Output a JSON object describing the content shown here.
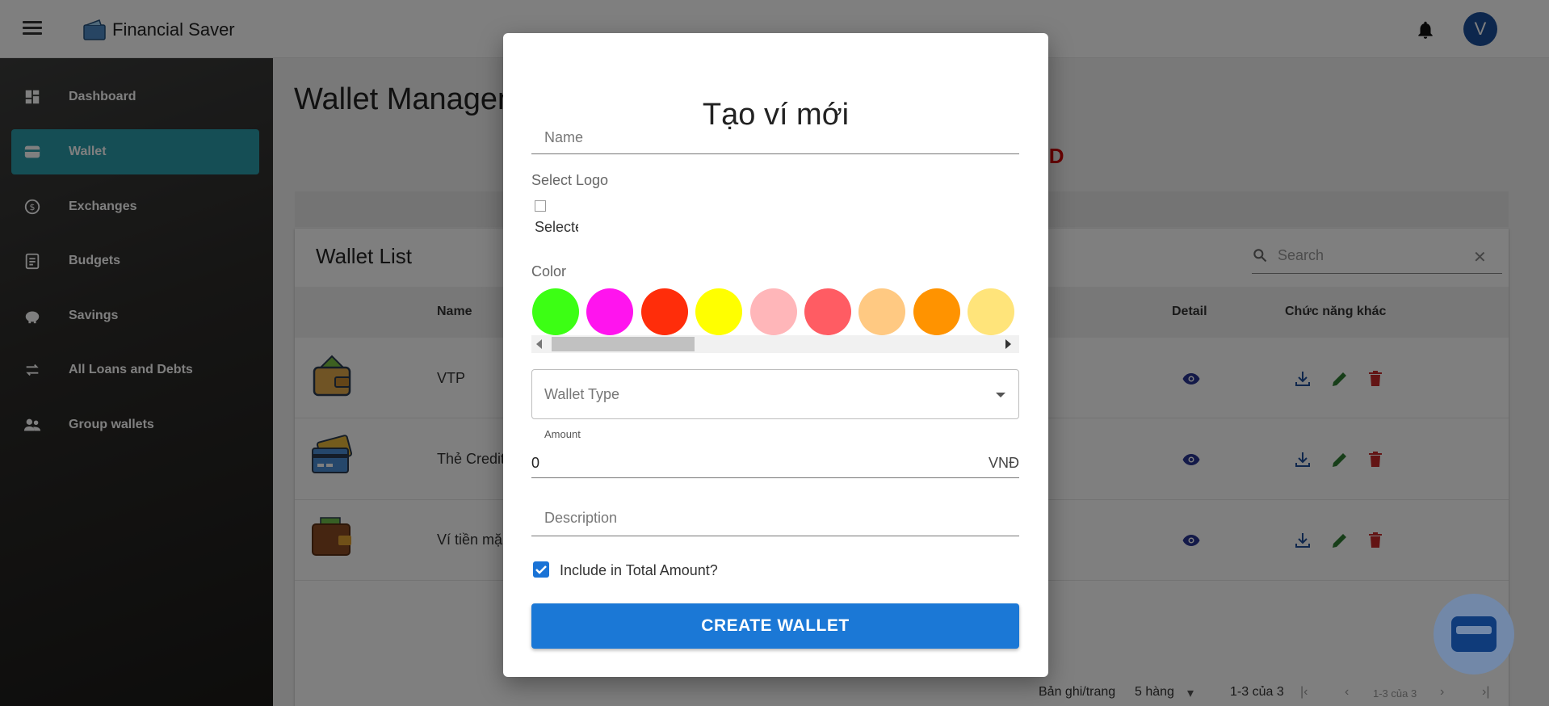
{
  "app": {
    "title": "Financial Saver",
    "avatar_initial": "V"
  },
  "sidebar": {
    "items": [
      {
        "label": "Dashboard",
        "icon": "dashboard-icon"
      },
      {
        "label": "Wallet",
        "icon": "wallet-icon",
        "active": true
      },
      {
        "label": "Exchanges",
        "icon": "exchange-icon"
      },
      {
        "label": "Budgets",
        "icon": "clipboard-icon"
      },
      {
        "label": "Savings",
        "icon": "piggy-bank-icon"
      },
      {
        "label": "All Loans and Debts",
        "icon": "swap-arrows-icon"
      },
      {
        "label": "Group wallets",
        "icon": "group-icon"
      }
    ]
  },
  "page": {
    "title": "Wallet Managem",
    "total_amount_fragment": "ND",
    "wallet_list_title": "Wallet List",
    "search_placeholder": "Search"
  },
  "table": {
    "headers": {
      "name": "Name",
      "detail": "Detail",
      "other": "Chức năng khác"
    },
    "rows": [
      {
        "name": "VTP",
        "icon": "wallet-coin-icon"
      },
      {
        "name": "Thẻ Credit",
        "icon": "credit-card-icon"
      },
      {
        "name": "Ví tiền mặ",
        "icon": "cash-wallet-icon"
      }
    ]
  },
  "pagination": {
    "rows_per_page_label": "Bản ghi/trang",
    "rows_per_page_value": "5 hàng",
    "range": "1-3 của 3",
    "range_small": "1-3 của 3"
  },
  "modal": {
    "title": "Tạo ví mới",
    "name_placeholder": "Name",
    "select_logo_label": "Select Logo",
    "logo_alt": "Selecte",
    "color_label": "Color",
    "colors": [
      "#3cff14",
      "#ff14ee",
      "#ff2d0a",
      "#ffff00",
      "#ffb6b9",
      "#ff5c63",
      "#ffc982",
      "#ff9300",
      "#ffe47a"
    ],
    "wallet_type_placeholder": "Wallet Type",
    "amount_label": "Amount",
    "amount_value": "0",
    "amount_unit": "VNĐ",
    "description_placeholder": "Description",
    "include_label": "Include in Total Amount?",
    "include_checked": true,
    "create_button": "CREATE WALLET"
  }
}
